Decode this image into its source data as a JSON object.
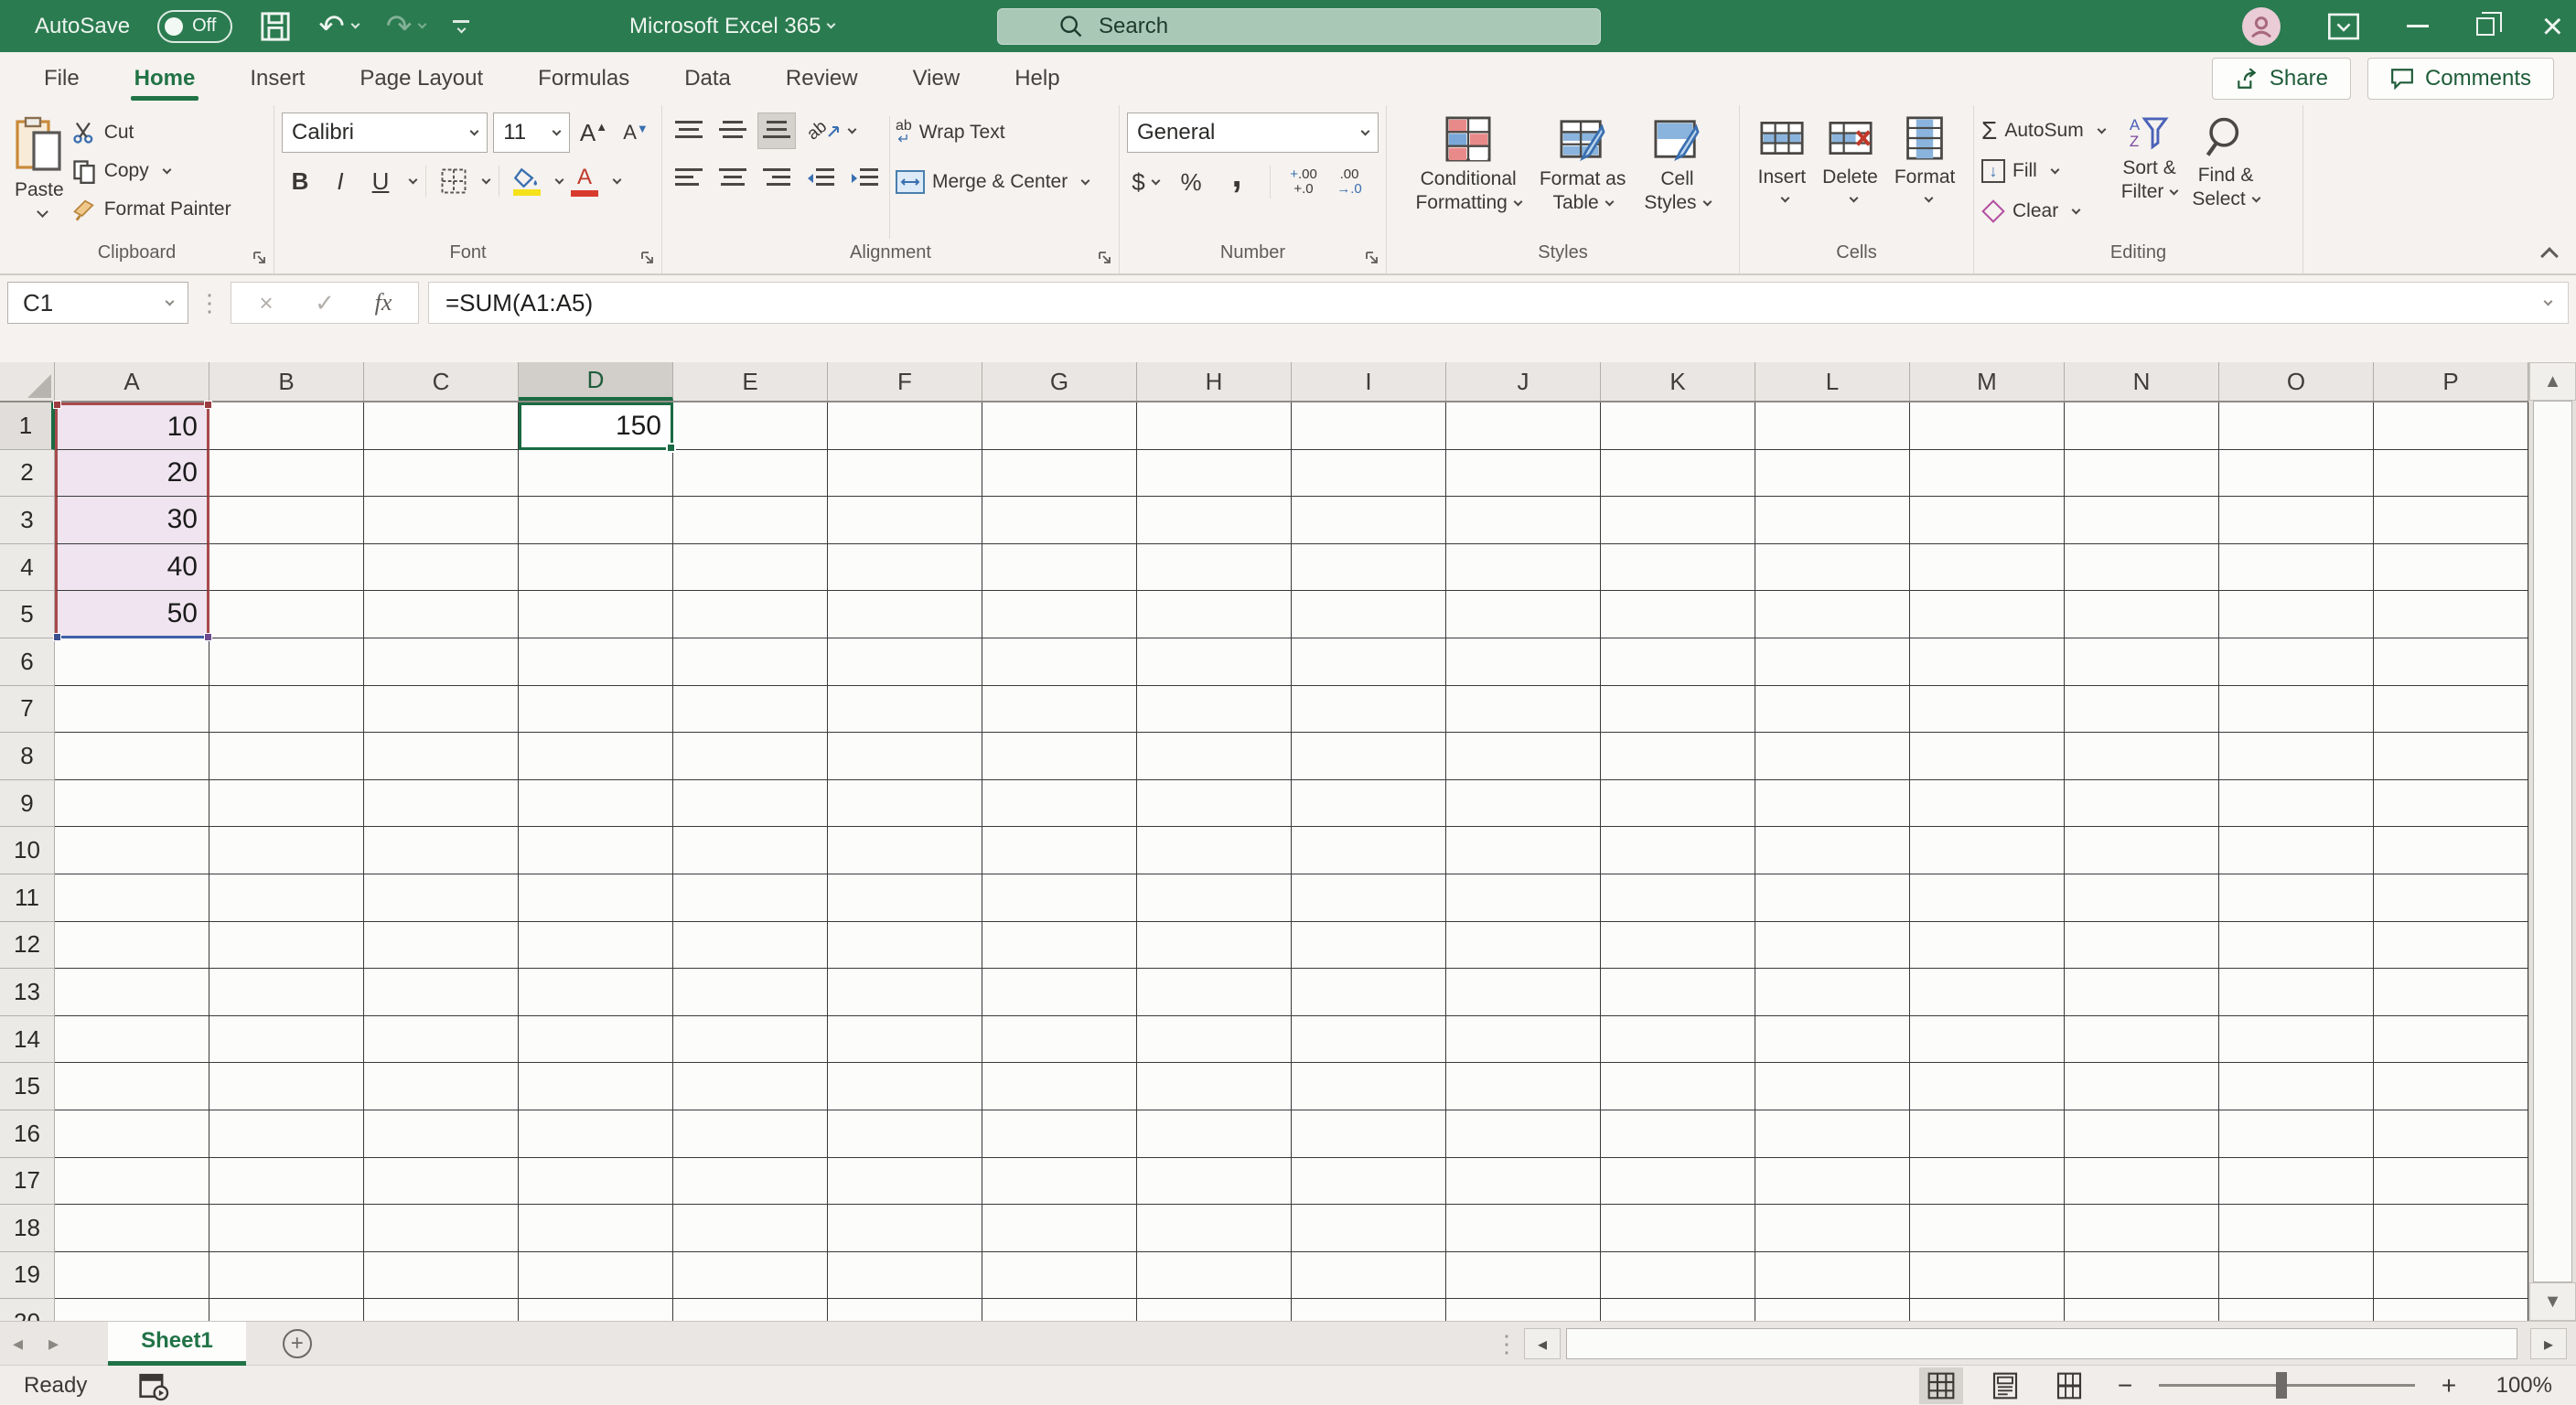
{
  "titlebar": {
    "autosave_label": "AutoSave",
    "autosave_state": "Off",
    "app_title": "Microsoft Excel 365",
    "search_placeholder": "Search"
  },
  "tabs": {
    "items": [
      {
        "label": "File"
      },
      {
        "label": "Home"
      },
      {
        "label": "Insert"
      },
      {
        "label": "Page Layout"
      },
      {
        "label": "Formulas"
      },
      {
        "label": "Data"
      },
      {
        "label": "Review"
      },
      {
        "label": "View"
      },
      {
        "label": "Help"
      }
    ],
    "active": "Home",
    "share_label": "Share",
    "comments_label": "Comments"
  },
  "ribbon": {
    "clipboard": {
      "label": "Clipboard",
      "paste": "Paste",
      "cut": "Cut",
      "copy": "Copy",
      "format_painter": "Format Painter"
    },
    "font": {
      "label": "Font",
      "font_name": "Calibri",
      "font_size": "11",
      "bold": "B",
      "italic": "I",
      "underline": "U",
      "grow": "A",
      "shrink": "A",
      "font_color_glyph": "A"
    },
    "alignment": {
      "label": "Alignment",
      "wrap_text": "Wrap Text",
      "merge_center": "Merge & Center",
      "orientation_glyph": "ab",
      "wrap_glyph": "ab"
    },
    "number": {
      "label": "Number",
      "format": "General",
      "currency": "$",
      "percent": "%",
      "comma": ",",
      "inc_top": "+.0",
      "inc_bot": ".00",
      "dec_top": ".00",
      "dec_bot": "→.0"
    },
    "styles": {
      "label": "Styles",
      "cf_line1": "Conditional",
      "cf_line2": "Formatting",
      "ft_line1": "Format as",
      "ft_line2": "Table",
      "cs_line1": "Cell",
      "cs_line2": "Styles"
    },
    "cells": {
      "label": "Cells",
      "insert": "Insert",
      "delete": "Delete",
      "format": "Format"
    },
    "editing": {
      "label": "Editing",
      "autosum_glyph": "Σ",
      "autosum": "AutoSum",
      "fill": "Fill",
      "clear": "Clear",
      "sf_line1": "Sort &",
      "sf_line2": "Filter",
      "fs_line1": "Find &",
      "fs_line2": "Select",
      "sort_a": "A",
      "sort_z": "Z"
    }
  },
  "formula_bar": {
    "name_box": "C1",
    "cancel_glyph": "×",
    "enter_glyph": "✓",
    "fx_glyph": "fx",
    "formula": "=SUM(A1:A5)"
  },
  "grid": {
    "columns": [
      "A",
      "B",
      "C",
      "D",
      "E",
      "F",
      "G",
      "H",
      "I",
      "J",
      "K",
      "L",
      "M",
      "N",
      "O",
      "P"
    ],
    "row_count": 20,
    "selected_column": "D",
    "selected_row": 1,
    "active_cell": "D1",
    "cells": [
      {
        "ref": "A1",
        "value": "10"
      },
      {
        "ref": "A2",
        "value": "20"
      },
      {
        "ref": "A3",
        "value": "30"
      },
      {
        "ref": "A4",
        "value": "40"
      },
      {
        "ref": "A5",
        "value": "50"
      },
      {
        "ref": "D1",
        "value": "150"
      }
    ],
    "highlight_range": {
      "col": "A",
      "from": 1,
      "to": 5
    }
  },
  "sheet_bar": {
    "tabs": [
      {
        "label": "Sheet1",
        "active": true
      }
    ]
  },
  "status_bar": {
    "mode": "Ready",
    "zoom_level": "100%"
  },
  "colors": {
    "accent_green": "#217346",
    "selection_green": "#1a6b43",
    "range_fill": "#efe4ef",
    "range_red": "#a84a4c",
    "range_blue": "#3f5fa8"
  }
}
